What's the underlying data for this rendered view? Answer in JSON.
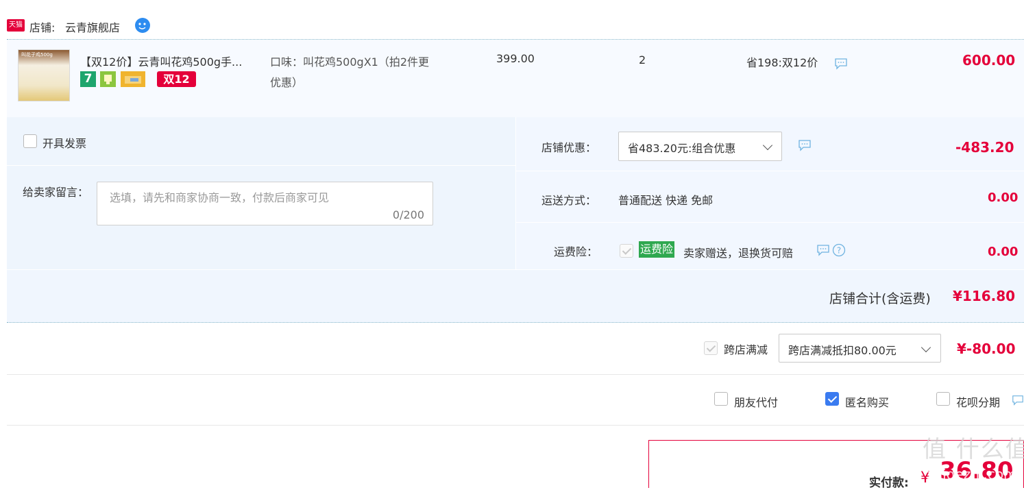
{
  "shop": {
    "badge": "天猫",
    "label": "店铺:",
    "name": "云青旗舰店"
  },
  "item": {
    "image_text": "叫花子鸡500g",
    "title": "【双12价】云青叫花鸡500g手...",
    "tag_7": "7",
    "tag_double12": "双12",
    "sku_line1": "口味：叫花鸡500gX1（拍2件更",
    "sku_line2": "优惠）",
    "unit_price": "399.00",
    "quantity": "2",
    "discount": "省198:双12价",
    "subtotal": "600.00"
  },
  "invoice": {
    "label": "开具发票",
    "checked": false
  },
  "message": {
    "label": "给卖家留言：",
    "placeholder": "选填，请先和商家协商一致，付款后商家可见",
    "counter": "0/200"
  },
  "shop_discount": {
    "label": "店铺优惠：",
    "selected": "省483.20元:组合优惠",
    "amount": "-483.20"
  },
  "shipping": {
    "label": "运送方式：",
    "value": "普通配送 快递 免邮",
    "amount": "0.00"
  },
  "insurance": {
    "label": "运费险：",
    "tag": "运费险",
    "text": "卖家赠送，退换货可赔",
    "amount": "0.00"
  },
  "shop_total": {
    "label": "店铺合计(含运费)",
    "amount": "¥116.80"
  },
  "cross_store": {
    "label": "跨店满减",
    "selected": "跨店满减抵扣80.00元",
    "amount": "¥-80.00"
  },
  "options": {
    "friend_pay": "朋友代付",
    "anonymous": "匿名购买",
    "installment": "花呗分期"
  },
  "pay": {
    "label": "实付款:",
    "currency": "¥",
    "amount": "36.80"
  },
  "watermark": {
    "text": "值 什么值得买",
    "url": "zhidezhi.com"
  },
  "colors": {
    "price_red": "#e4003a",
    "light_blue_bg": "#f2f7ff",
    "insurance_green": "#2fa84f",
    "checkbox_blue": "#3a7bf0"
  }
}
